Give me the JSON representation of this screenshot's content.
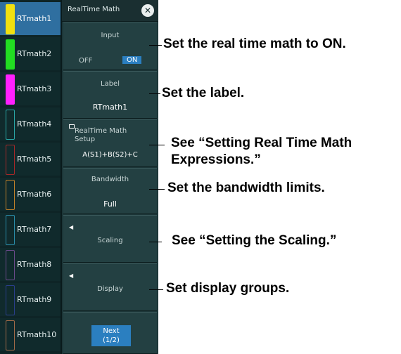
{
  "channels": [
    {
      "label": "RTmath1",
      "color": "#f0e010",
      "active": true
    },
    {
      "label": "RTmath2",
      "color": "#22dd22"
    },
    {
      "label": "RTmath3",
      "color": "#ff20ff"
    },
    {
      "label": "RTmath4",
      "color": "#2aa6a6"
    },
    {
      "label": "RTmath5",
      "color": "#a52828"
    },
    {
      "label": "RTmath6",
      "color": "#c0802a"
    },
    {
      "label": "RTmath7",
      "color": "#2a8ca8"
    },
    {
      "label": "RTmath8",
      "color": "#6a4a8a"
    },
    {
      "label": "RTmath9",
      "color": "#2a3e8a"
    },
    {
      "label": "RTmath10",
      "color": "#a06a48"
    }
  ],
  "panel": {
    "title": "RealTime Math",
    "close_icon": "close-icon",
    "input": {
      "label": "Input",
      "off": "OFF",
      "on": "ON"
    },
    "label_item": {
      "label": "Label",
      "value": "RTmath1"
    },
    "setup": {
      "label_line1": "RealTime Math",
      "label_line2": "Setup",
      "value": "A(S1)+B(S2)+C"
    },
    "bandwidth": {
      "label": "Bandwidth",
      "value": "Full"
    },
    "scaling": {
      "label": "Scaling"
    },
    "display": {
      "label": "Display"
    },
    "next": {
      "line1": "Next",
      "line2": "(1/2)"
    }
  },
  "annotations": {
    "input": "Set the real time math to ON.",
    "label": "Set the label.",
    "setup_line1": "See “Setting Real Time Math",
    "setup_line2": "Expressions.”",
    "bandwidth": "Set the bandwidth limits.",
    "scaling": "See “Setting the Scaling.”",
    "display": "Set display groups."
  }
}
